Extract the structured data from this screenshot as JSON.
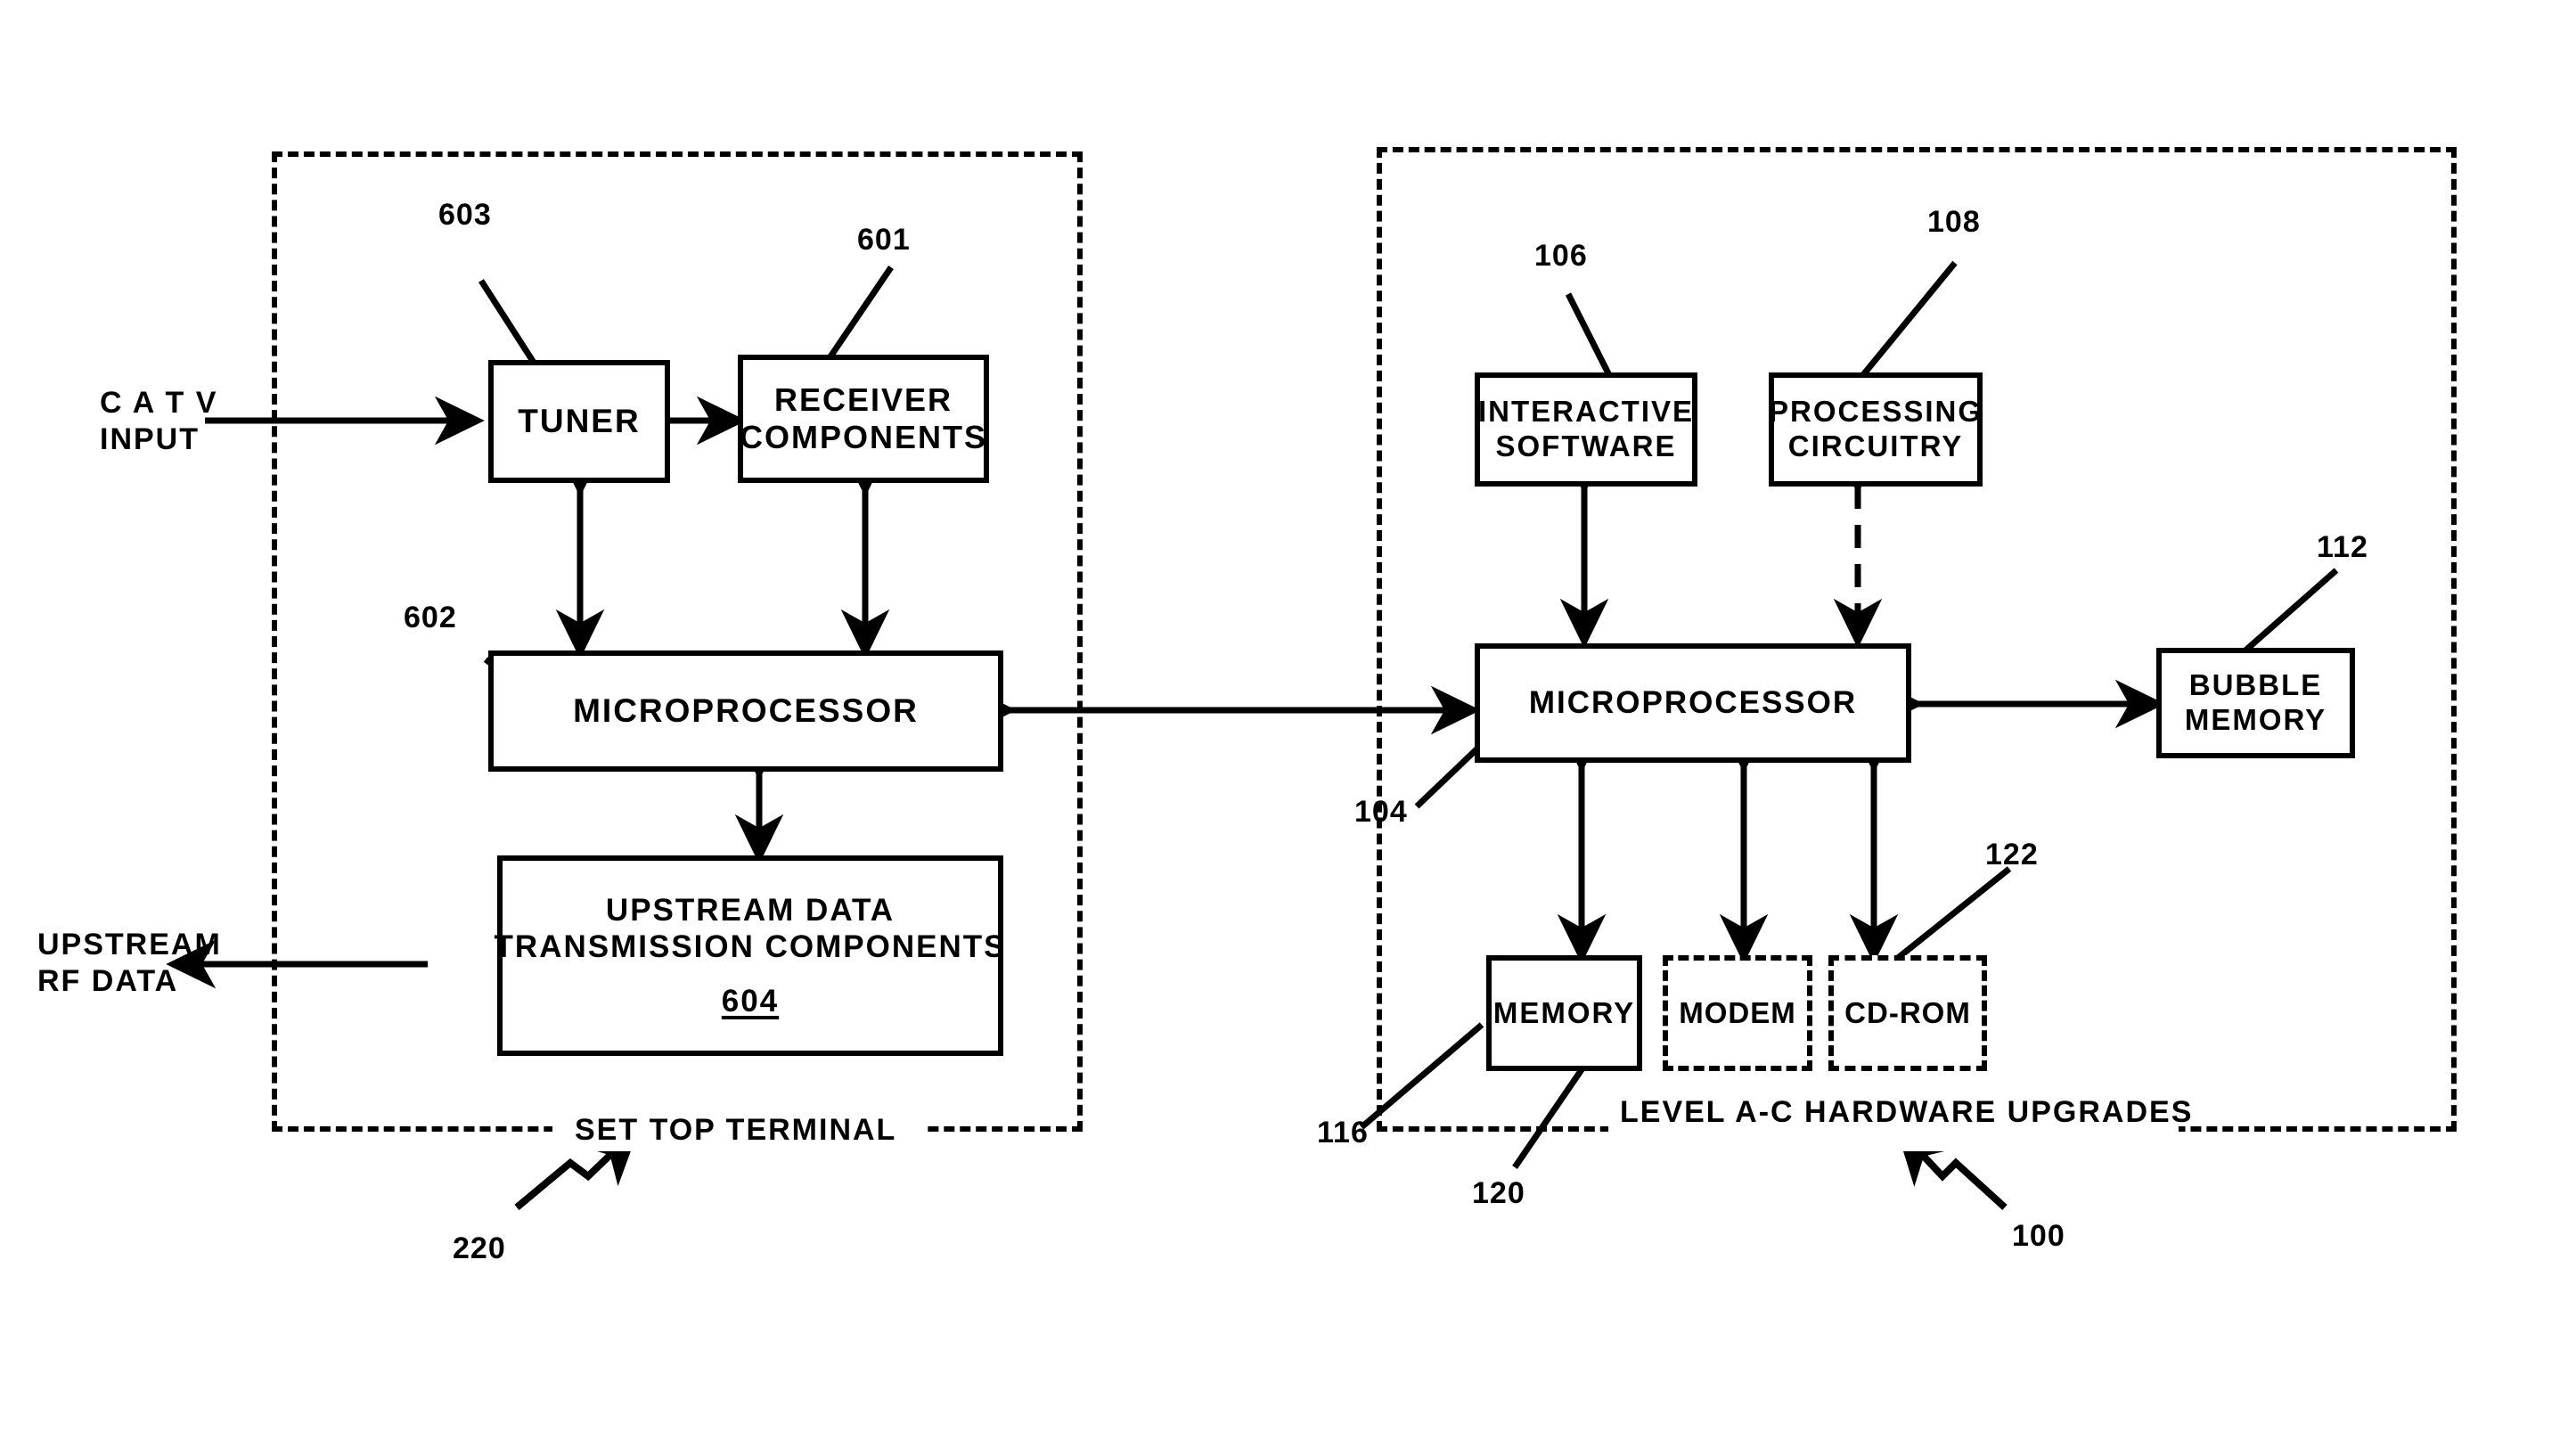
{
  "figure": {
    "title": "Set Top Terminal and Level A-C Hardware Upgrades block diagram"
  },
  "enclosures": [
    {
      "name": "set-top-terminal",
      "caption": "SET  TOP  TERMINAL",
      "ref": "220"
    },
    {
      "name": "level-a-c-hardware-upgrades",
      "caption": "LEVEL  A-C  HARDWARE  UPGRADES",
      "ref": "100"
    }
  ],
  "blocks": {
    "tuner": {
      "label": "TUNER",
      "ref": "603"
    },
    "receiver_components": {
      "line1": "RECEIVER",
      "line2": "COMPONENTS",
      "ref": "601"
    },
    "microprocessor_left": {
      "label": "MICROPROCESSOR",
      "ref": "602"
    },
    "upstream_data": {
      "line1": "UPSTREAM   DATA",
      "line2": "TRANSMISSION   COMPONENTS",
      "ref": "604"
    },
    "interactive_software": {
      "line1": "INTERACTIVE",
      "line2": "SOFTWARE",
      "ref": "106"
    },
    "processing_circuitry": {
      "line1": "PROCESSING",
      "line2": "CIRCUITRY",
      "ref": "108"
    },
    "microprocessor_right": {
      "label": "MICROPROCESSOR",
      "ref": "104"
    },
    "bubble_memory": {
      "line1": "BUBBLE",
      "line2": "MEMORY",
      "ref": "112"
    },
    "memory": {
      "label": "MEMORY",
      "ref": "116"
    },
    "modem": {
      "label": "MODEM",
      "ref": "120"
    },
    "cdrom": {
      "label": "CD-ROM",
      "ref": "122"
    }
  },
  "io_labels": {
    "catv_input": {
      "line1": "C A T V",
      "line2": "INPUT"
    },
    "upstream_rf": {
      "line1": "UPSTREAM",
      "line2": "RF  DATA"
    }
  },
  "reference_numerals": [
    "603",
    "601",
    "602",
    "604",
    "220",
    "106",
    "108",
    "112",
    "104",
    "116",
    "120",
    "122",
    "100"
  ],
  "colors": {
    "ink": "#000000",
    "paper": "#ffffff"
  }
}
